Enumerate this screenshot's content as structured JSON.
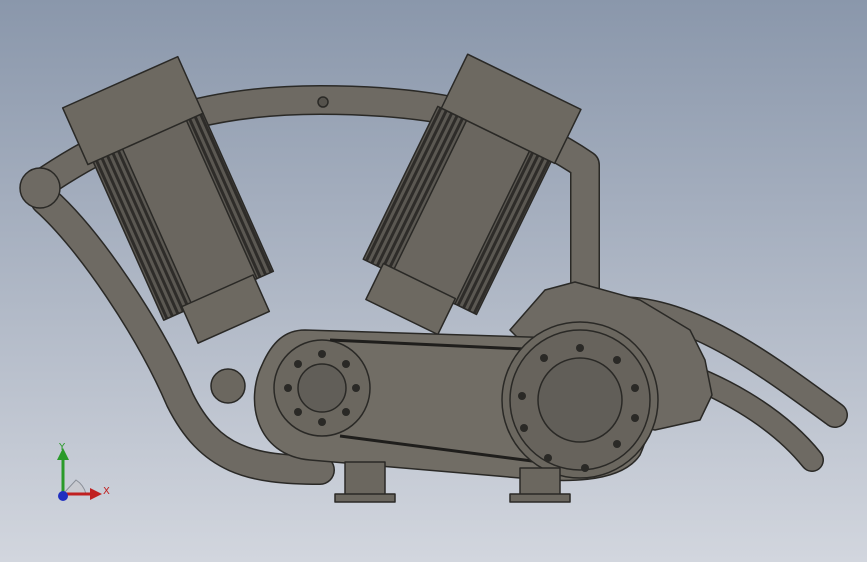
{
  "viewport": {
    "background_top": "#8a97ab",
    "background_bottom": "#d2d6de",
    "model_color": "#6a665f"
  },
  "triad": {
    "x_label": "X",
    "y_label": "Y",
    "x_color": "#c02020",
    "y_color": "#2a9a2a",
    "z_color": "#2030c0"
  }
}
